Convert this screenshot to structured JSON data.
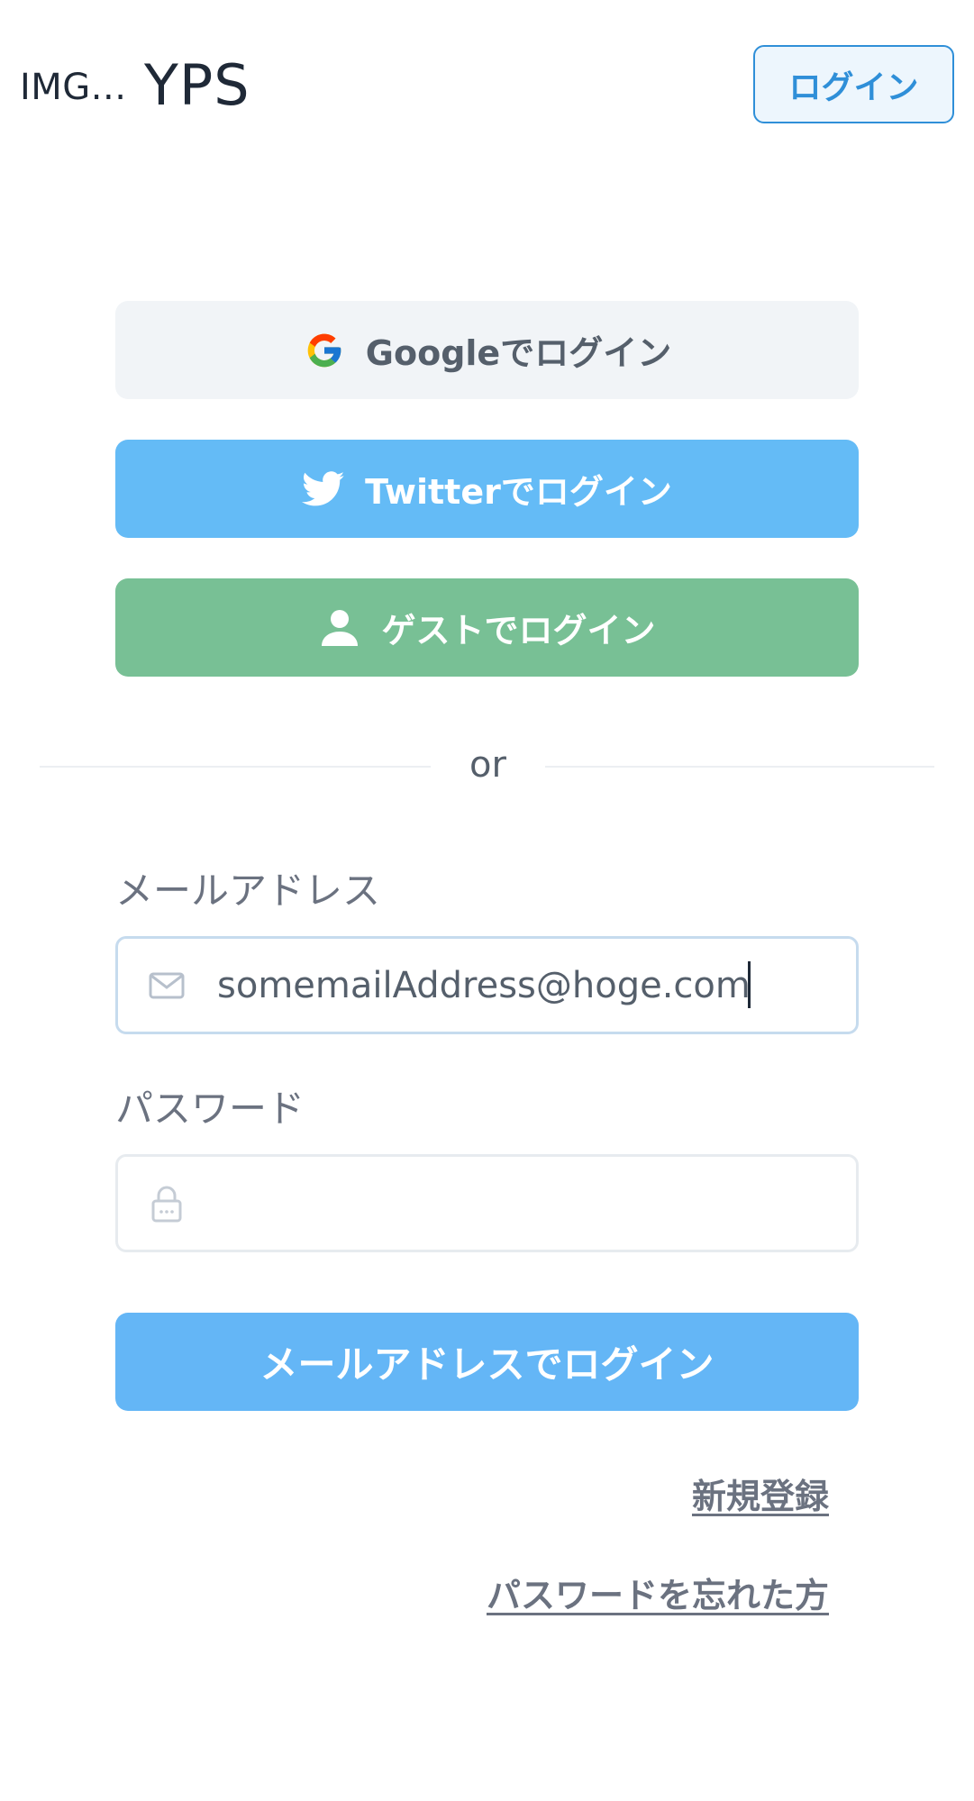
{
  "header": {
    "logo_alt": "IMG...",
    "title": "YPS",
    "login_button": "ログイン"
  },
  "social": {
    "google": {
      "label": "Googleでログイン",
      "icon": "google-icon"
    },
    "twitter": {
      "label": "Twitterでログイン",
      "icon": "twitter-bird-icon"
    },
    "guest": {
      "label": "ゲストでログイン",
      "icon": "user-icon"
    }
  },
  "divider": {
    "text": "or"
  },
  "form": {
    "email_label": "メールアドレス",
    "email_value": "somemailAddress@hoge.com",
    "email_icon": "mail-icon",
    "password_label": "パスワード",
    "password_value": "",
    "password_icon": "lock-icon",
    "submit_label": "メールアドレスでログイン"
  },
  "links": {
    "register": "新規登録",
    "forgot_password": "パスワードを忘れた方"
  },
  "colors": {
    "accent_blue": "#2f8fd8",
    "twitter_blue": "#64bbf6",
    "guest_green": "#78c095",
    "google_bg": "#f1f4f7"
  }
}
